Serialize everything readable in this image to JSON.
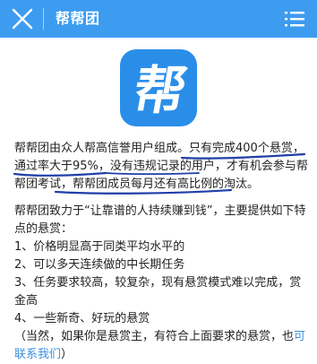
{
  "header": {
    "title": "帮帮团",
    "close_icon": "close-icon",
    "menu_icon": "list-menu-icon",
    "bg_color": "#3d9cf0"
  },
  "logo": {
    "glyph": "帮",
    "bg_color": "#2a8ee9"
  },
  "content": {
    "p1_a": "帮帮团由众人帮高信誉用户组成。",
    "p1_b": "只有完成400个悬赏，通过率大于95%，没有违规记录",
    "p1_c": "的用户，才有机会参与帮帮团考试，",
    "p1_d": "帮帮团成员每月还有高比例的淘汰。",
    "p2_intro": "帮帮团致力于“让靠谱的人持续赚到钱”，主要提供如下特点的悬赏：",
    "items": [
      "1、价格明显高于同类平均水平的",
      "2、可以多天连续做的中长期任务",
      "3、任务要求较高，较复杂，现有悬赏模式难以完成，赏金高",
      "4、一些新奇、好玩的悬赏"
    ],
    "note_a": "（当然，如果你是悬赏主，有符合上面要求的悬赏，也",
    "note_link": "可联系我们",
    "note_b": "）"
  },
  "annotation_color": "#1f3fa8"
}
